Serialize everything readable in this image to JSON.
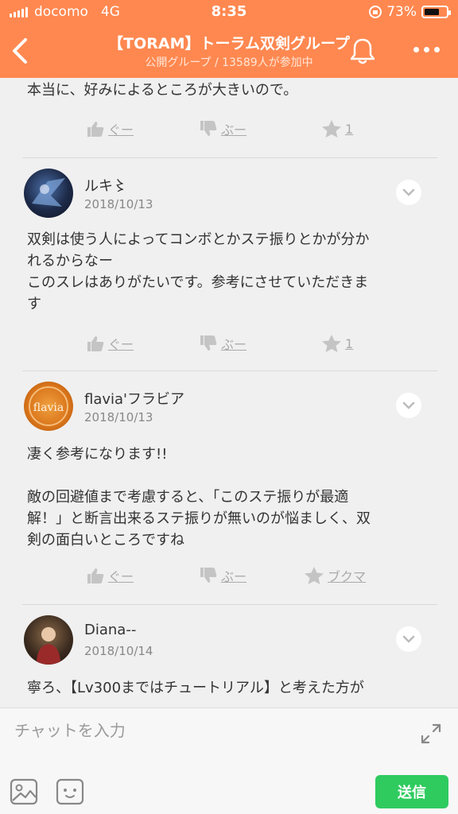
{
  "status_bar": {
    "carrier": "docomo",
    "network": "4G",
    "time": "8:35",
    "battery": "73%",
    "battery_level": 0.73
  },
  "header": {
    "title": "【TORAM】トーラム双剣グループ",
    "subtitle": "公開グループ / 13589人が参加中"
  },
  "reaction_labels": {
    "good": "ぐー",
    "boo": "ぶー"
  },
  "posts": [
    {
      "text_lines": [
        "本当に、好みによるところが大きいので。"
      ],
      "star_label": "1"
    },
    {
      "username": "ルキ〻",
      "date": "2018/10/13",
      "text_lines": [
        "双剣は使う人によってコンボとかステ振りとかが分か",
        "れるからなー",
        "このスレはありがたいです。参考にさせていただきま",
        "す"
      ],
      "star_label": "1"
    },
    {
      "username": "flavia'フラビア",
      "avatar_text": "flavia",
      "date": "2018/10/13",
      "text_lines": [
        "凄く参考になります!!",
        "",
        "敵の回避値まで考慮すると、「このステ振りが最適",
        "解！」と断言出来るステ振りが無いのが悩ましく、双",
        "剣の面白いところですね"
      ],
      "star_label": "ブクマ"
    },
    {
      "username": "Diana--",
      "date": "2018/10/14",
      "text_lines": [
        "寧ろ、【Lv300まではチュートリアル】と考えた方が"
      ]
    }
  ],
  "input": {
    "placeholder": "チャットを入力",
    "send_label": "送信"
  },
  "colors": {
    "header_bg": "#ff8850",
    "send_bg": "#2fcb5f"
  }
}
